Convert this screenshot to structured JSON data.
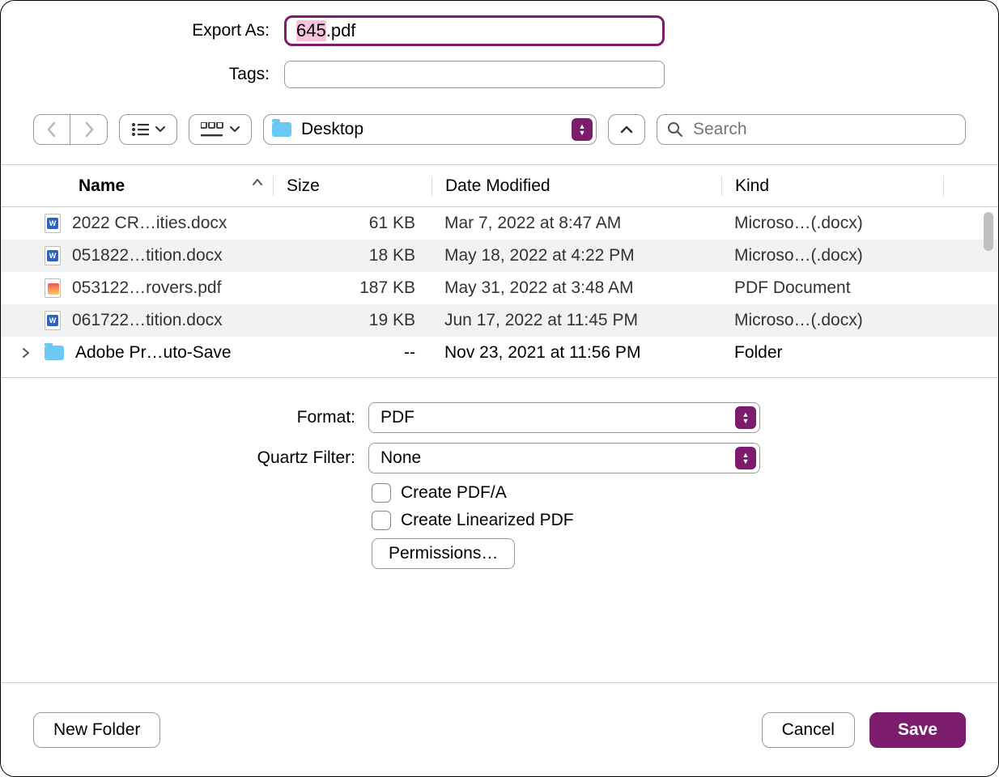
{
  "labels": {
    "export_as": "Export As:",
    "tags": "Tags:",
    "format": "Format:",
    "quartz_filter": "Quartz Filter:"
  },
  "filename": {
    "selected_part": "645",
    "rest_part": ".pdf"
  },
  "location": {
    "name": "Desktop"
  },
  "search": {
    "placeholder": "Search"
  },
  "columns": {
    "name": "Name",
    "size": "Size",
    "date": "Date Modified",
    "kind": "Kind"
  },
  "files": [
    {
      "icon": "word",
      "name": "2022 CR…ities.docx",
      "size": "61 KB",
      "date": "Mar 7, 2022 at 8:47 AM",
      "kind": "Microso…(.docx)",
      "alt": false,
      "folder": false
    },
    {
      "icon": "word",
      "name": "051822…tition.docx",
      "size": "18 KB",
      "date": "May 18, 2022 at 4:22 PM",
      "kind": "Microso…(.docx)",
      "alt": true,
      "folder": false
    },
    {
      "icon": "pdf",
      "name": "053122…rovers.pdf",
      "size": "187 KB",
      "date": "May 31, 2022 at 3:48 AM",
      "kind": "PDF Document",
      "alt": false,
      "folder": false
    },
    {
      "icon": "word",
      "name": "061722…tition.docx",
      "size": "19 KB",
      "date": "Jun 17, 2022 at 11:45 PM",
      "kind": "Microso…(.docx)",
      "alt": true,
      "folder": false
    },
    {
      "icon": "folder",
      "name": "Adobe Pr…uto-Save",
      "size": "--",
      "date": "Nov 23, 2021 at 11:56 PM",
      "kind": "Folder",
      "alt": false,
      "folder": true
    }
  ],
  "format": {
    "value": "PDF"
  },
  "quartz_filter": {
    "value": "None"
  },
  "checkboxes": {
    "pdf_a": "Create PDF/A",
    "linearized": "Create Linearized PDF"
  },
  "buttons": {
    "permissions": "Permissions…",
    "new_folder": "New Folder",
    "cancel": "Cancel",
    "save": "Save"
  }
}
